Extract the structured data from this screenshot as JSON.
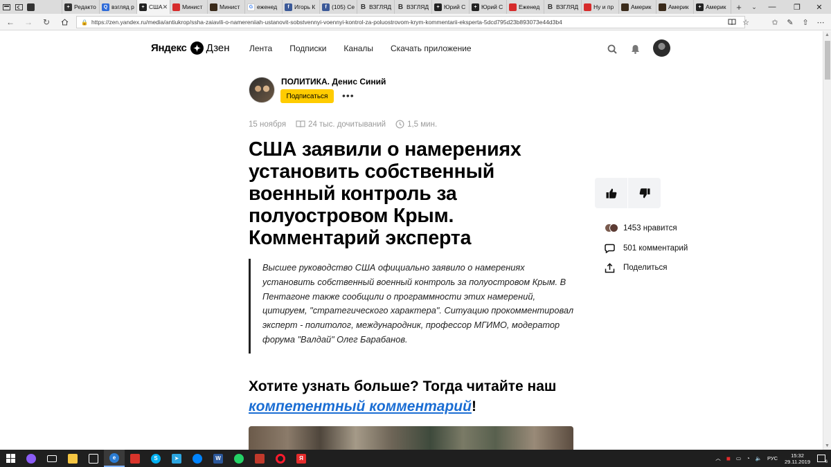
{
  "browser": {
    "tabs": [
      {
        "label": "",
        "color": "#333333",
        "icon": "tab-preview-icon"
      },
      {
        "label": "Редакто",
        "color": "#333333",
        "icon": "plus-square-icon"
      },
      {
        "label": "взгляд р",
        "color": "#2f6bd8",
        "icon": "search-icon"
      },
      {
        "label": "США",
        "color": "#222222",
        "icon": "plus-square-icon",
        "active": true
      },
      {
        "label": "Минист",
        "color": "#d62b2b",
        "icon": "flame-icon"
      },
      {
        "label": "Минист",
        "color": "#3a2a1a",
        "icon": "image-icon"
      },
      {
        "label": "еженед",
        "color": "#ffffff",
        "icon": "google-icon"
      },
      {
        "label": "Игорь К",
        "color": "#3b5998",
        "icon": "facebook-icon"
      },
      {
        "label": "(105) Се",
        "color": "#3b5998",
        "icon": "facebook-icon"
      },
      {
        "label": "ВЗГЛЯД",
        "color": "#444444",
        "icon": "vzglyad-icon"
      },
      {
        "label": "ВЗГЛЯД",
        "color": "#444444",
        "icon": "vzglyad-icon"
      },
      {
        "label": "Юрий С",
        "color": "#222222",
        "icon": "plus-square-icon"
      },
      {
        "label": "Юрий С",
        "color": "#222222",
        "icon": "plus-square-icon"
      },
      {
        "label": "Еженед",
        "color": "#d62b2b",
        "icon": "flame-icon"
      },
      {
        "label": "ВЗГЛЯД",
        "color": "#444444",
        "icon": "vzglyad-icon"
      },
      {
        "label": "Ну и пр",
        "color": "#d62b2b",
        "icon": "flame-icon"
      },
      {
        "label": "Америк",
        "color": "#3a2a1a",
        "icon": "image-icon"
      },
      {
        "label": "Америк",
        "color": "#3a2a1a",
        "icon": "image-icon"
      },
      {
        "label": "Америк",
        "color": "#222222",
        "icon": "plus-square-icon"
      }
    ],
    "url": "https://zen.yandex.ru/media/antiukrop/ssha-zaiavili-o-namereniiah-ustanovit-sobstvennyi-voennyi-kontrol-za-poluostrovom-krym-kommentarii-eksperta-5dcd795d23b893073e44d3b4"
  },
  "header": {
    "logo_left": "Яндекс",
    "logo_right": "Дзен",
    "nav": [
      "Лента",
      "Подписки",
      "Каналы",
      "Скачать приложение"
    ]
  },
  "channel": {
    "name": "ПОЛИТИКА. Денис Синий",
    "subscribe_label": "Подписаться",
    "more_label": "•••"
  },
  "article": {
    "date": "15 ноября",
    "reads": "24 тыс. дочитываний",
    "read_time": "1,5 мин.",
    "title": "США заявили о намерениях установить собственный военный контроль за полуостровом Крым. Комментарий эксперта",
    "lead": "Высшее руководство США официально заявило о намерениях установить собственный военный контроль за полуостровом Крым. В Пентагоне также сообщили о программности этих намерений, цитируем, \"стратегического характера\". Ситуацию прокомментировал эксперт - политолог, международник, профессор МГИМО, модератор форума \"Валдай\" Олег Барабанов.",
    "cta_text": "Хотите узнать больше? Тогда читайте наш ",
    "cta_link": "компетентный комментарий",
    "cta_end": "!"
  },
  "sidebar": {
    "likes": "1453 нравится",
    "comments": "501 комментарий",
    "share": "Поделиться"
  },
  "taskbar": {
    "lang": "РУС",
    "time": "15:32",
    "date": "29.11.2019",
    "notifications": "6"
  },
  "colors": {
    "accent": "#ffcc00",
    "link": "#1a6dd3"
  }
}
